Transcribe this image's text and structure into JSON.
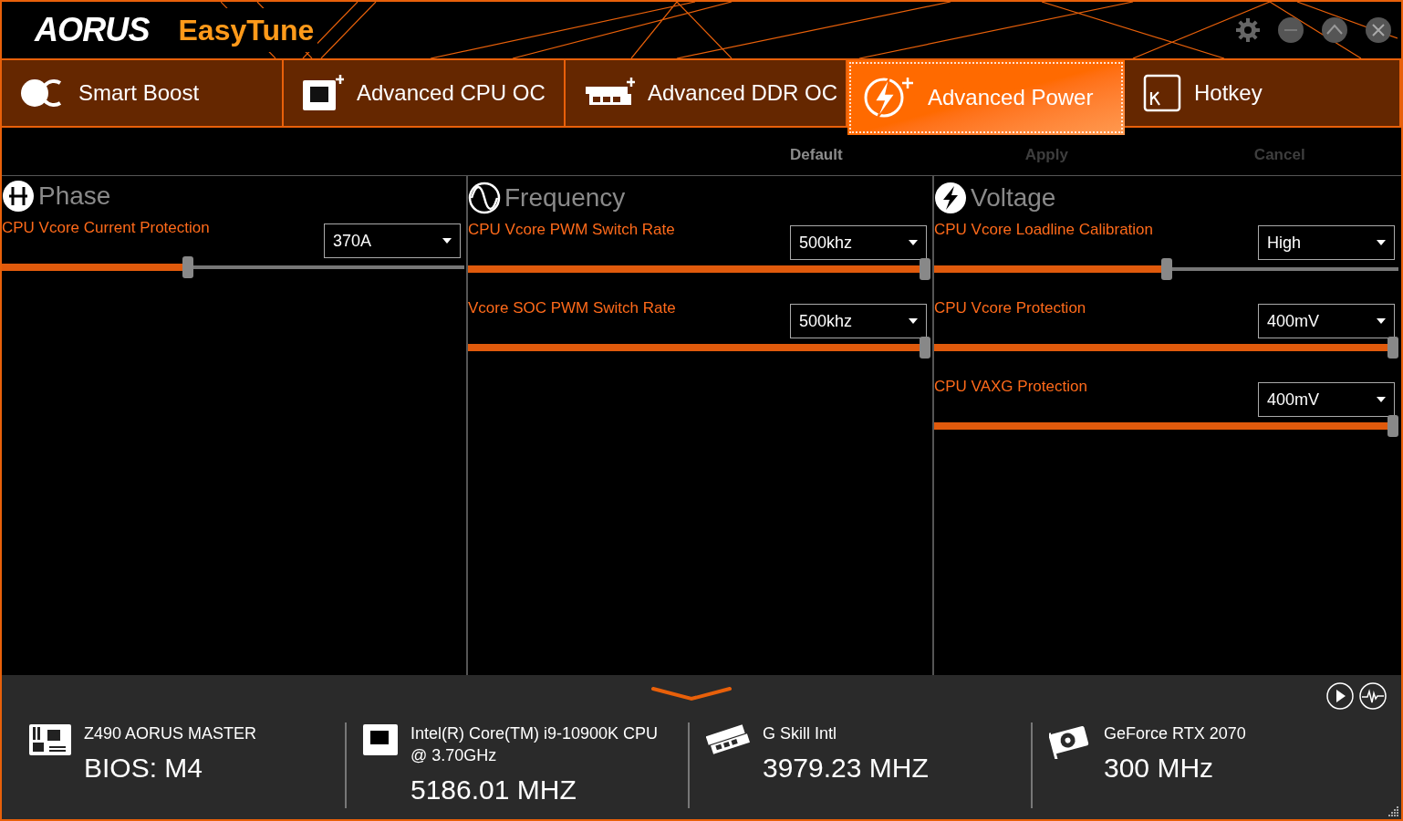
{
  "header": {
    "brand": "AORUS",
    "app_name": "EasyTune"
  },
  "tabs": [
    {
      "label": "Smart Boost",
      "kind": "boost",
      "selected": false
    },
    {
      "label": "Advanced CPU OC",
      "kind": "cpu",
      "selected": false
    },
    {
      "label": "Advanced DDR OC",
      "kind": "ddr",
      "selected": false
    },
    {
      "label": "Advanced Power",
      "kind": "power",
      "selected": true
    },
    {
      "label": "Hotkey",
      "kind": "hotkey",
      "selected": false
    }
  ],
  "actions": [
    {
      "label": "Default",
      "disabled": false
    },
    {
      "label": "Apply",
      "disabled": true
    },
    {
      "label": "Cancel",
      "disabled": true
    }
  ],
  "panels": [
    {
      "title": "Phase",
      "kind": "phase",
      "settings": [
        {
          "label": "CPU Vcore Current Protection",
          "value": "370A",
          "level": 0.4
        }
      ]
    },
    {
      "title": "Frequency",
      "kind": "frequency",
      "settings": [
        {
          "label": "CPU Vcore PWM Switch Rate",
          "value": "500khz",
          "level": 1
        },
        {
          "label": "Vcore SOC PWM Switch Rate",
          "value": "500khz",
          "level": 1
        }
      ]
    },
    {
      "title": "Voltage",
      "kind": "voltage",
      "settings": [
        {
          "label": "CPU Vcore Loadline Calibration",
          "value": "High",
          "level": 0.5
        },
        {
          "label": "CPU Vcore Protection",
          "value": "400mV",
          "level": 1
        },
        {
          "label": "CPU VAXG Protection",
          "value": "400mV",
          "level": 1
        }
      ]
    }
  ],
  "info": [
    {
      "kind": "board",
      "name": "Z490 AORUS MASTER",
      "value": "BIOS: M4"
    },
    {
      "kind": "cpu",
      "name": "Intel(R) Core(TM) i9-10900K CPU @ 3.70GHz",
      "value": "5186.01 MHZ"
    },
    {
      "kind": "memory",
      "name": "G Skill Intl",
      "value": "3979.23 MHZ"
    },
    {
      "kind": "gpu",
      "name": "GeForce RTX 2070",
      "value": "300 MHz"
    }
  ]
}
